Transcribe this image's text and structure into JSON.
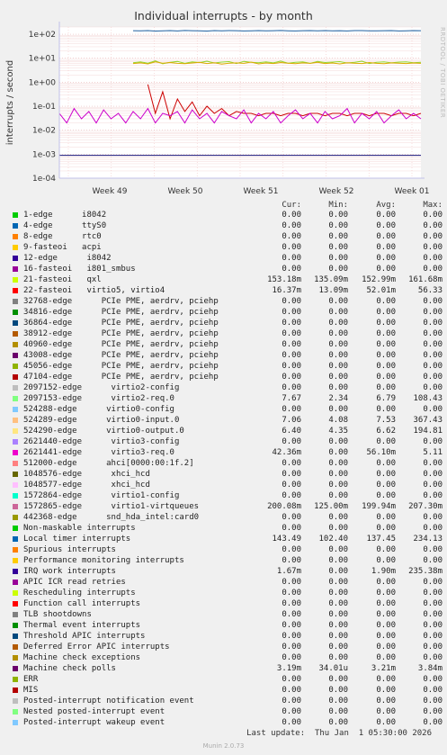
{
  "chart_data": {
    "type": "line",
    "title": "Individual interrupts - by month",
    "ylabel": "interrupts / second",
    "yscale": "log",
    "ylim": [
      0.0001,
      200
    ],
    "y_ticks": [
      "1e+02",
      "1e+01",
      "1e+00",
      "1e-01",
      "1e-02",
      "1e-03",
      "1e-04"
    ],
    "x_ticks": [
      "Week 49",
      "Week 50",
      "Week 51",
      "Week 52",
      "Week 01"
    ],
    "grid": true,
    "series_traces": [
      {
        "name": "Local timer interrupts",
        "color": "#1f5f9f",
        "values": [
          null,
          null,
          null,
          null,
          null,
          null,
          null,
          null,
          null,
          null,
          140,
          138,
          142,
          136,
          139,
          141,
          137,
          143,
          140,
          138,
          136,
          141,
          139,
          142,
          140,
          137,
          139,
          141,
          138,
          140,
          143,
          139,
          137,
          140,
          142,
          138,
          141,
          139,
          140,
          137,
          141,
          142,
          139,
          138,
          140,
          141,
          137,
          139,
          142,
          140
        ]
      },
      {
        "name": "21-fasteoi   qxl",
        "color": "#8fd62b",
        "values": [
          null,
          null,
          null,
          null,
          null,
          null,
          null,
          null,
          null,
          null,
          6.5,
          7.1,
          6.2,
          7.8,
          5.9,
          6.8,
          7.3,
          6.1,
          7.0,
          6.6,
          7.5,
          6.3,
          6.9,
          7.2,
          6.0,
          7.4,
          6.7,
          6.5,
          7.1,
          6.4,
          7.6,
          6.2,
          6.8,
          7.0,
          6.1,
          7.3,
          6.6,
          6.9,
          7.2,
          6.3,
          6.7,
          7.5,
          6.0,
          6.8,
          7.1,
          6.4,
          6.9,
          7.0,
          6.5,
          6.8
        ]
      },
      {
        "name": "Machine check polls",
        "color": "#ddaa00",
        "values": [
          null,
          null,
          null,
          null,
          null,
          null,
          null,
          null,
          null,
          null,
          6.0,
          6.4,
          5.8,
          7.0,
          6.2,
          6.6,
          6.1,
          5.9,
          6.3,
          6.8,
          6.0,
          6.5,
          5.7,
          6.2,
          6.4,
          6.1,
          6.9,
          5.8,
          6.3,
          6.0,
          6.6,
          6.2,
          5.9,
          6.4,
          6.1,
          6.7,
          6.0,
          6.3,
          5.8,
          6.5,
          6.2,
          6.0,
          6.6,
          6.1,
          5.9,
          6.4,
          6.2,
          6.0,
          6.3,
          6.1
        ]
      },
      {
        "name": "22-fasteoi   virtio5, virtio4",
        "color": "#cc0000",
        "values": [
          null,
          null,
          null,
          null,
          null,
          null,
          null,
          null,
          null,
          null,
          null,
          null,
          0.8,
          0.05,
          0.4,
          0.03,
          0.2,
          0.06,
          0.15,
          0.04,
          0.1,
          0.05,
          0.08,
          0.04,
          0.06,
          0.05,
          0.05,
          0.04,
          0.05,
          0.05,
          0.04,
          0.05,
          0.05,
          0.04,
          0.05,
          0.05,
          0.04,
          0.05,
          0.05,
          0.04,
          0.05,
          0.05,
          0.04,
          0.05,
          0.05,
          0.04,
          0.05,
          0.05,
          0.04,
          0.05
        ]
      },
      {
        "name": "2621441-edge  virtio3-req.0",
        "color": "#cc00cc",
        "values": [
          0.05,
          0.02,
          0.08,
          0.03,
          0.06,
          0.02,
          0.07,
          0.03,
          0.05,
          0.02,
          0.06,
          0.03,
          0.08,
          0.02,
          0.05,
          0.04,
          0.06,
          0.02,
          0.07,
          0.03,
          0.05,
          0.02,
          0.06,
          0.04,
          0.03,
          0.07,
          0.02,
          0.05,
          0.03,
          0.06,
          0.02,
          0.04,
          0.07,
          0.03,
          0.05,
          0.02,
          0.06,
          0.03,
          0.04,
          0.08,
          0.02,
          0.05,
          0.03,
          0.06,
          0.02,
          0.04,
          0.07,
          0.03,
          0.05,
          0.03
        ]
      },
      {
        "name": "12-edge      i8042",
        "color": "#1a1a80",
        "values": [
          0.0009,
          0.0009,
          0.0009,
          0.0009,
          0.0009,
          0.0009,
          0.0009,
          0.0009,
          0.0009,
          0.0009,
          0.0009,
          0.0009,
          0.0009,
          0.0009,
          0.0009,
          0.0009,
          0.0009,
          0.0009,
          0.0009,
          0.0009,
          0.0009,
          0.0009,
          0.0009,
          0.0009,
          0.0009,
          0.0009,
          0.0009,
          0.0009,
          0.0009,
          0.0009,
          0.0009,
          0.0009,
          0.0009,
          0.0009,
          0.0009,
          0.0009,
          0.0009,
          0.0009,
          0.0009,
          0.0009,
          0.0009,
          0.0009,
          0.0009,
          0.0009,
          0.0009,
          0.0009,
          0.0009,
          0.0009,
          0.0009,
          0.0009
        ]
      }
    ],
    "legend_headers": [
      "Cur:",
      "Min:",
      "Avg:",
      "Max:"
    ],
    "legend": [
      {
        "label": "1-edge      i8042",
        "color": "#00cc00",
        "cur": "0.00",
        "min": "0.00",
        "avg": "0.00",
        "max": "0.00"
      },
      {
        "label": "4-edge      ttyS0",
        "color": "#0066b3",
        "cur": "0.00",
        "min": "0.00",
        "avg": "0.00",
        "max": "0.00"
      },
      {
        "label": "8-edge      rtc0",
        "color": "#ff8000",
        "cur": "0.00",
        "min": "0.00",
        "avg": "0.00",
        "max": "0.00"
      },
      {
        "label": "9-fasteoi   acpi",
        "color": "#ffcc00",
        "cur": "0.00",
        "min": "0.00",
        "avg": "0.00",
        "max": "0.00"
      },
      {
        "label": "12-edge      i8042",
        "color": "#330099",
        "cur": "0.00",
        "min": "0.00",
        "avg": "0.00",
        "max": "0.00"
      },
      {
        "label": "16-fasteoi   i801_smbus",
        "color": "#990099",
        "cur": "0.00",
        "min": "0.00",
        "avg": "0.00",
        "max": "0.00"
      },
      {
        "label": "21-fasteoi   qxl",
        "color": "#ccff00",
        "cur": "153.18m",
        "min": "135.09m",
        "avg": "152.99m",
        "max": "161.68m"
      },
      {
        "label": "22-fasteoi   virtio5, virtio4",
        "color": "#ff0000",
        "cur": "16.37m",
        "min": "13.09m",
        "avg": "52.01m",
        "max": "56.33"
      },
      {
        "label": "32768-edge      PCIe PME, aerdrv, pciehp",
        "color": "#808080",
        "cur": "0.00",
        "min": "0.00",
        "avg": "0.00",
        "max": "0.00"
      },
      {
        "label": "34816-edge      PCIe PME, aerdrv, pciehp",
        "color": "#008f00",
        "cur": "0.00",
        "min": "0.00",
        "avg": "0.00",
        "max": "0.00"
      },
      {
        "label": "36864-edge      PCIe PME, aerdrv, pciehp",
        "color": "#00487d",
        "cur": "0.00",
        "min": "0.00",
        "avg": "0.00",
        "max": "0.00"
      },
      {
        "label": "38912-edge      PCIe PME, aerdrv, pciehp",
        "color": "#b35a00",
        "cur": "0.00",
        "min": "0.00",
        "avg": "0.00",
        "max": "0.00"
      },
      {
        "label": "40960-edge      PCIe PME, aerdrv, pciehp",
        "color": "#b38f00",
        "cur": "0.00",
        "min": "0.00",
        "avg": "0.00",
        "max": "0.00"
      },
      {
        "label": "43008-edge      PCIe PME, aerdrv, pciehp",
        "color": "#6b006b",
        "cur": "0.00",
        "min": "0.00",
        "avg": "0.00",
        "max": "0.00"
      },
      {
        "label": "45056-edge      PCIe PME, aerdrv, pciehp",
        "color": "#8fb300",
        "cur": "0.00",
        "min": "0.00",
        "avg": "0.00",
        "max": "0.00"
      },
      {
        "label": "47104-edge      PCIe PME, aerdrv, pciehp",
        "color": "#b30000",
        "cur": "0.00",
        "min": "0.00",
        "avg": "0.00",
        "max": "0.00"
      },
      {
        "label": "2097152-edge      virtio2-config",
        "color": "#bebebe",
        "cur": "0.00",
        "min": "0.00",
        "avg": "0.00",
        "max": "0.00"
      },
      {
        "label": "2097153-edge      virtio2-req.0",
        "color": "#80ff80",
        "cur": "7.67",
        "min": "2.34",
        "avg": "6.79",
        "max": "108.43"
      },
      {
        "label": "524288-edge      virtio0-config",
        "color": "#80c9ff",
        "cur": "0.00",
        "min": "0.00",
        "avg": "0.00",
        "max": "0.00"
      },
      {
        "label": "524289-edge      virtio0-input.0",
        "color": "#ffc080",
        "cur": "7.06",
        "min": "4.08",
        "avg": "7.53",
        "max": "367.43"
      },
      {
        "label": "524290-edge      virtio0-output.0",
        "color": "#ffe680",
        "cur": "6.40",
        "min": "4.35",
        "avg": "6.62",
        "max": "194.81"
      },
      {
        "label": "2621440-edge      virtio3-config",
        "color": "#aa80ff",
        "cur": "0.00",
        "min": "0.00",
        "avg": "0.00",
        "max": "0.00"
      },
      {
        "label": "2621441-edge      virtio3-req.0",
        "color": "#ee00cc",
        "cur": "42.36m",
        "min": "0.00",
        "avg": "56.10m",
        "max": "5.11"
      },
      {
        "label": "512000-edge      ahci[0000:00:1f.2]",
        "color": "#ff8080",
        "cur": "0.00",
        "min": "0.00",
        "avg": "0.00",
        "max": "0.00"
      },
      {
        "label": "1048576-edge      xhci_hcd",
        "color": "#666600",
        "cur": "0.00",
        "min": "0.00",
        "avg": "0.00",
        "max": "0.00"
      },
      {
        "label": "1048577-edge      xhci_hcd",
        "color": "#ffbfff",
        "cur": "0.00",
        "min": "0.00",
        "avg": "0.00",
        "max": "0.00"
      },
      {
        "label": "1572864-edge      virtio1-config",
        "color": "#00ffcc",
        "cur": "0.00",
        "min": "0.00",
        "avg": "0.00",
        "max": "0.00"
      },
      {
        "label": "1572865-edge      virtio1-virtqueues",
        "color": "#cc6699",
        "cur": "200.08m",
        "min": "125.00m",
        "avg": "199.94m",
        "max": "207.30m"
      },
      {
        "label": "442368-edge      snd_hda_intel:card0",
        "color": "#999900",
        "cur": "0.00",
        "min": "0.00",
        "avg": "0.00",
        "max": "0.00"
      },
      {
        "label": "Non-maskable interrupts",
        "color": "#00cc00",
        "cur": "0.00",
        "min": "0.00",
        "avg": "0.00",
        "max": "0.00"
      },
      {
        "label": "Local timer interrupts",
        "color": "#0066b3",
        "cur": "143.49",
        "min": "102.40",
        "avg": "137.45",
        "max": "234.13"
      },
      {
        "label": "Spurious interrupts",
        "color": "#ff8000",
        "cur": "0.00",
        "min": "0.00",
        "avg": "0.00",
        "max": "0.00"
      },
      {
        "label": "Performance monitoring interrupts",
        "color": "#ffcc00",
        "cur": "0.00",
        "min": "0.00",
        "avg": "0.00",
        "max": "0.00"
      },
      {
        "label": "IRQ work interrupts",
        "color": "#330099",
        "cur": "1.67m",
        "min": "0.00",
        "avg": "1.90m",
        "max": "235.38m"
      },
      {
        "label": "APIC ICR read retries",
        "color": "#990099",
        "cur": "0.00",
        "min": "0.00",
        "avg": "0.00",
        "max": "0.00"
      },
      {
        "label": "Rescheduling interrupts",
        "color": "#ccff00",
        "cur": "0.00",
        "min": "0.00",
        "avg": "0.00",
        "max": "0.00"
      },
      {
        "label": "Function call interrupts",
        "color": "#ff0000",
        "cur": "0.00",
        "min": "0.00",
        "avg": "0.00",
        "max": "0.00"
      },
      {
        "label": "TLB shootdowns",
        "color": "#808080",
        "cur": "0.00",
        "min": "0.00",
        "avg": "0.00",
        "max": "0.00"
      },
      {
        "label": "Thermal event interrupts",
        "color": "#008f00",
        "cur": "0.00",
        "min": "0.00",
        "avg": "0.00",
        "max": "0.00"
      },
      {
        "label": "Threshold APIC interrupts",
        "color": "#00487d",
        "cur": "0.00",
        "min": "0.00",
        "avg": "0.00",
        "max": "0.00"
      },
      {
        "label": "Deferred Error APIC interrupts",
        "color": "#b35a00",
        "cur": "0.00",
        "min": "0.00",
        "avg": "0.00",
        "max": "0.00"
      },
      {
        "label": "Machine check exceptions",
        "color": "#b38f00",
        "cur": "0.00",
        "min": "0.00",
        "avg": "0.00",
        "max": "0.00"
      },
      {
        "label": "Machine check polls",
        "color": "#6b006b",
        "cur": "3.19m",
        "min": "34.01u",
        "avg": "3.21m",
        "max": "3.84m"
      },
      {
        "label": "ERR",
        "color": "#8fb300",
        "cur": "0.00",
        "min": "0.00",
        "avg": "0.00",
        "max": "0.00"
      },
      {
        "label": "MIS",
        "color": "#b30000",
        "cur": "0.00",
        "min": "0.00",
        "avg": "0.00",
        "max": "0.00"
      },
      {
        "label": "Posted-interrupt notification event",
        "color": "#bebebe",
        "cur": "0.00",
        "min": "0.00",
        "avg": "0.00",
        "max": "0.00"
      },
      {
        "label": "Nested posted-interrupt event",
        "color": "#80ff80",
        "cur": "0.00",
        "min": "0.00",
        "avg": "0.00",
        "max": "0.00"
      },
      {
        "label": "Posted-interrupt wakeup event",
        "color": "#80c9ff",
        "cur": "0.00",
        "min": "0.00",
        "avg": "0.00",
        "max": "0.00"
      }
    ]
  },
  "side_credit": "RRDTOOL / TOBI OETIKER",
  "last_update": "Last update:  Thu Jan  1 05:30:00 2026",
  "footer": "Munin 2.0.73"
}
